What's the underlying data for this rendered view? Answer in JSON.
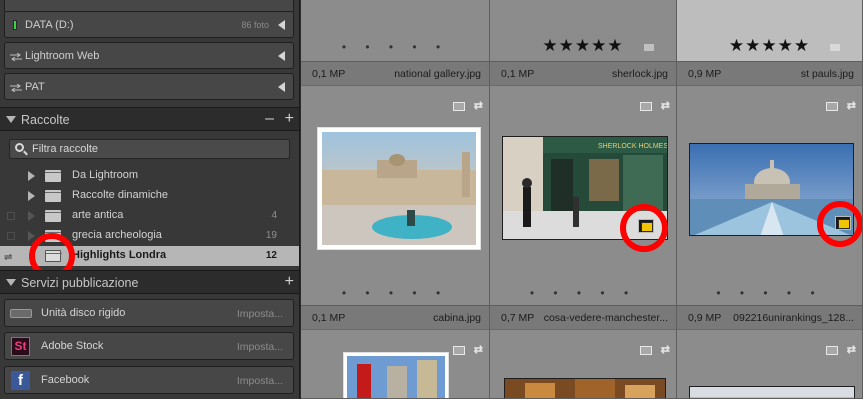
{
  "left_panel": {
    "volumes": [
      {
        "name": "DATA (D:)",
        "count": "86 foto",
        "light": "#3bd44b"
      },
      {
        "name": "Lightroom Web",
        "count": ""
      },
      {
        "name": "PAT",
        "count": ""
      }
    ],
    "collections_section": {
      "title": "Raccolte",
      "minus": "–",
      "plus": "+",
      "filter_label": "Filtra raccolte",
      "items": [
        {
          "name": "Da Lightroom",
          "count": ""
        },
        {
          "name": "Raccolte dinamiche",
          "count": ""
        },
        {
          "name": "arte antica",
          "count": "4"
        },
        {
          "name": "grecia archeologia",
          "count": "19"
        },
        {
          "name": "Highlights Londra",
          "count": "12"
        }
      ]
    },
    "publish_section": {
      "title": "Servizi pubblicazione",
      "plus": "+",
      "services": [
        {
          "name": "Unità disco rigido",
          "setup": "Imposta..."
        },
        {
          "name": "Adobe Stock",
          "setup": "Imposta..."
        },
        {
          "name": "Facebook",
          "setup": "Imposta..."
        }
      ]
    }
  },
  "grid": {
    "top_row_rating": [
      "",
      "★★★★★",
      "★★★★★"
    ],
    "rows": [
      [
        {
          "mp": "0,1 MP",
          "filename": "national gallery.jpg"
        },
        {
          "mp": "0,1 MP",
          "filename": "sherlock.jpg"
        },
        {
          "mp": "0,9 MP",
          "filename": "st pauls.jpg"
        }
      ],
      [
        {
          "mp": "0,1 MP",
          "filename": "cabina.jpg"
        },
        {
          "mp": "0,7 MP",
          "filename": "cosa-vedere-manchester..."
        },
        {
          "mp": "0,9 MP",
          "filename": "092216unirankings_128..."
        }
      ]
    ],
    "dots": "• • • • •"
  },
  "colors": {
    "panel_bg": "#383838",
    "grid_bg": "#8c8c8c",
    "selection": "#b6b6b6",
    "highlight_ring": "#ff0000",
    "note_badge": "#f2c500"
  }
}
